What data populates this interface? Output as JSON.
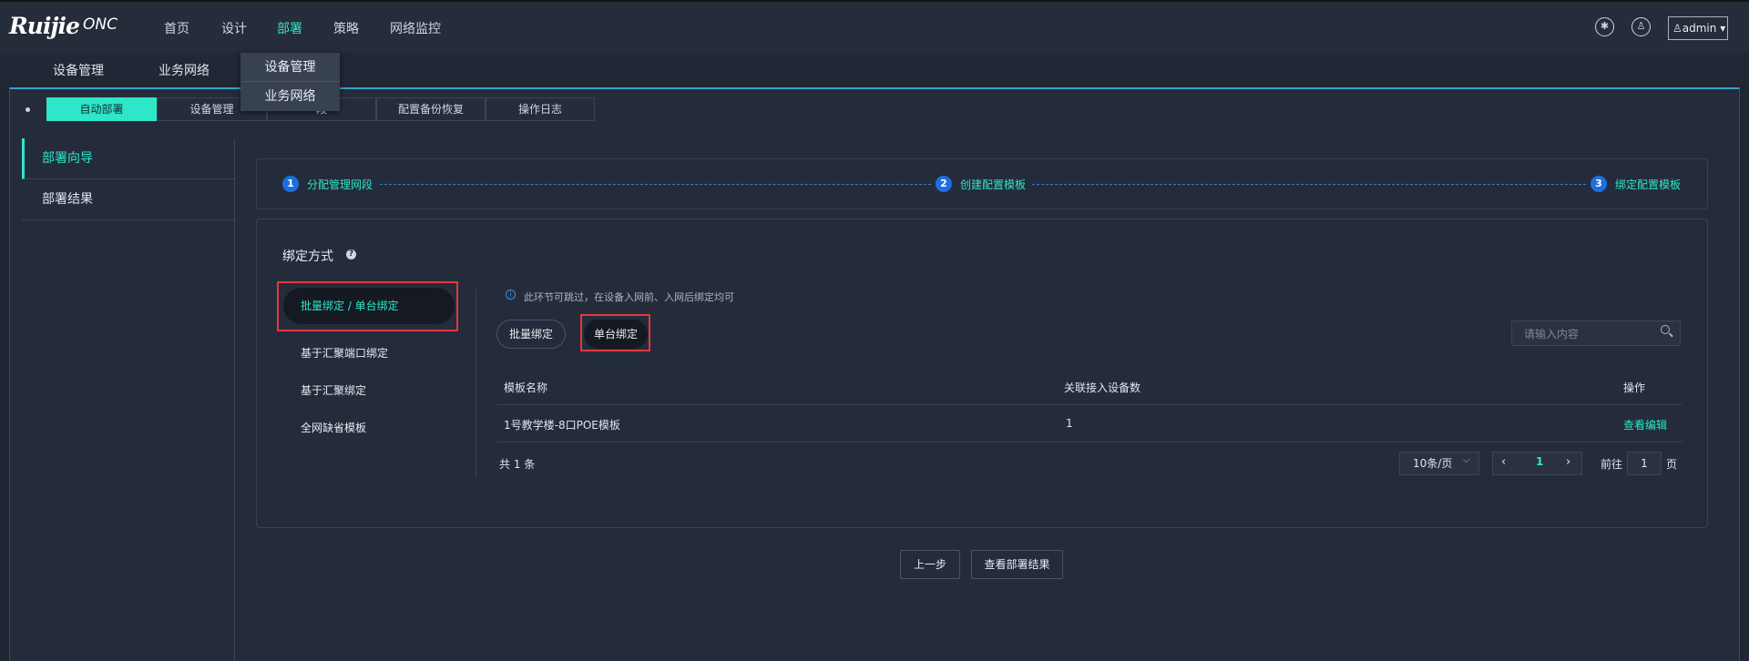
{
  "app": {
    "logo": "Ruijie",
    "logo_sub": "ONC"
  },
  "topnav": [
    {
      "label": "首页",
      "active": false
    },
    {
      "label": "设计",
      "active": false
    },
    {
      "label": "部署",
      "active": true
    },
    {
      "label": "策略",
      "active": false
    },
    {
      "label": "网络监控",
      "active": false
    }
  ],
  "user": {
    "name": "admin"
  },
  "subnav": [
    "设备管理",
    "业务网络"
  ],
  "dropdown": [
    "设备管理",
    "业务网络"
  ],
  "tabs": [
    "自动部署",
    "设备管理",
    "段",
    "配置备份恢复",
    "操作日志"
  ],
  "leftmenu": [
    "部署向导",
    "部署结果"
  ],
  "steps": [
    {
      "num": "1",
      "label": "分配管理网段"
    },
    {
      "num": "2",
      "label": "创建配置模板"
    },
    {
      "num": "3",
      "label": "绑定配置模板"
    }
  ],
  "bind": {
    "title": "绑定方式",
    "help": "?",
    "methods": [
      "批量绑定 / 单台绑定",
      "基于汇聚端口绑定",
      "基于汇聚绑定",
      "全网缺省模板"
    ],
    "note": "此环节可跳过，在设备入网前、入网后绑定均可",
    "buttons": {
      "batch": "批量绑定",
      "single": "单台绑定"
    },
    "search_placeholder": "请输入内容",
    "table": {
      "headers": [
        "模板名称",
        "关联接入设备数",
        "操作"
      ],
      "rows": [
        {
          "name": "1号教学楼-8口POE模板",
          "count": "1",
          "action": "查看编辑"
        }
      ]
    },
    "pagination": {
      "total": "共 1 条",
      "page_size": "10条/页",
      "current": "1",
      "goto_label": "前往",
      "goto_value": "1",
      "goto_suffix": "页",
      "prev": "‹",
      "next": "›"
    }
  },
  "footer": {
    "prev": "上一步",
    "view_results": "查看部署结果"
  }
}
